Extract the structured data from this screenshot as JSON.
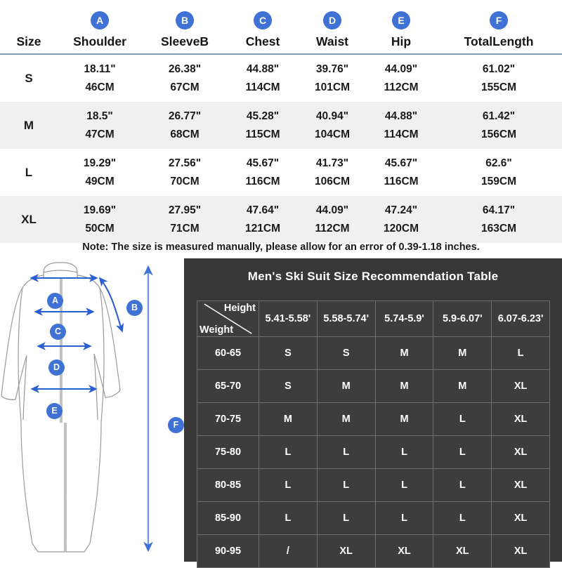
{
  "size_table": {
    "size_header": "Size",
    "columns": [
      {
        "badge": "A",
        "label": "Shoulder"
      },
      {
        "badge": "B",
        "label": "SleeveB"
      },
      {
        "badge": "C",
        "label": "Chest"
      },
      {
        "badge": "D",
        "label": "Waist"
      },
      {
        "badge": "E",
        "label": "Hip"
      },
      {
        "badge": "F",
        "label": "TotalLength"
      }
    ],
    "rows": [
      {
        "size": "S",
        "cells": [
          {
            "inch": "18.11\"",
            "cm": "46CM"
          },
          {
            "inch": "26.38\"",
            "cm": "67CM"
          },
          {
            "inch": "44.88\"",
            "cm": "114CM"
          },
          {
            "inch": "39.76\"",
            "cm": "101CM"
          },
          {
            "inch": "44.09\"",
            "cm": "112CM"
          },
          {
            "inch": "61.02\"",
            "cm": "155CM"
          }
        ]
      },
      {
        "size": "M",
        "cells": [
          {
            "inch": "18.5\"",
            "cm": "47CM"
          },
          {
            "inch": "26.77\"",
            "cm": "68CM"
          },
          {
            "inch": "45.28\"",
            "cm": "115CM"
          },
          {
            "inch": "40.94\"",
            "cm": "104CM"
          },
          {
            "inch": "44.88\"",
            "cm": "114CM"
          },
          {
            "inch": "61.42\"",
            "cm": "156CM"
          }
        ]
      },
      {
        "size": "L",
        "cells": [
          {
            "inch": "19.29\"",
            "cm": "49CM"
          },
          {
            "inch": "27.56\"",
            "cm": "70CM"
          },
          {
            "inch": "45.67\"",
            "cm": "116CM"
          },
          {
            "inch": "41.73\"",
            "cm": "106CM"
          },
          {
            "inch": "45.67\"",
            "cm": "116CM"
          },
          {
            "inch": "62.6\"",
            "cm": "159CM"
          }
        ]
      },
      {
        "size": "XL",
        "cells": [
          {
            "inch": "19.69\"",
            "cm": "50CM"
          },
          {
            "inch": "27.95\"",
            "cm": "71CM"
          },
          {
            "inch": "47.64\"",
            "cm": "121CM"
          },
          {
            "inch": "44.09\"",
            "cm": "112CM"
          },
          {
            "inch": "47.24\"",
            "cm": "120CM"
          },
          {
            "inch": "64.17\"",
            "cm": "163CM"
          }
        ]
      }
    ],
    "note": "Note: The size is measured manually, please allow for an error of 0.39-1.18 inches."
  },
  "diagram": {
    "badges": [
      {
        "letter": "A",
        "meaning": "shoulder"
      },
      {
        "letter": "B",
        "meaning": "sleeve"
      },
      {
        "letter": "C",
        "meaning": "chest"
      },
      {
        "letter": "D",
        "meaning": "waist"
      },
      {
        "letter": "E",
        "meaning": "hip"
      },
      {
        "letter": "F",
        "meaning": "total-length"
      }
    ]
  },
  "recommendation": {
    "title": "Men's Ski Suit Size Recommendation Table",
    "corner": {
      "height_label": "Height",
      "weight_label": "Weight"
    },
    "height_ranges": [
      "5.41-5.58'",
      "5.58-5.74'",
      "5.74-5.9'",
      "5.9-6.07'",
      "6.07-6.23'"
    ],
    "rows": [
      {
        "weight": "60-65",
        "sizes": [
          "S",
          "S",
          "M",
          "M",
          "L"
        ]
      },
      {
        "weight": "65-70",
        "sizes": [
          "S",
          "M",
          "M",
          "M",
          "XL"
        ]
      },
      {
        "weight": "70-75",
        "sizes": [
          "M",
          "M",
          "M",
          "L",
          "XL"
        ]
      },
      {
        "weight": "75-80",
        "sizes": [
          "L",
          "L",
          "L",
          "L",
          "XL"
        ]
      },
      {
        "weight": "80-85",
        "sizes": [
          "L",
          "L",
          "L",
          "L",
          "XL"
        ]
      },
      {
        "weight": "85-90",
        "sizes": [
          "L",
          "L",
          "L",
          "L",
          "XL"
        ]
      },
      {
        "weight": "90-95",
        "sizes": [
          "/",
          "XL",
          "XL",
          "XL",
          "XL"
        ]
      }
    ]
  },
  "colors": {
    "accent_blue": "#3f72d4",
    "header_rule": "#8a9ac6",
    "stripe_gray": "#f0f0f0",
    "panel_dark": "#373737",
    "cell_dark": "#3d3d3d",
    "cell_border": "#6e6e6e",
    "outline_gray": "#9a9a9a"
  }
}
